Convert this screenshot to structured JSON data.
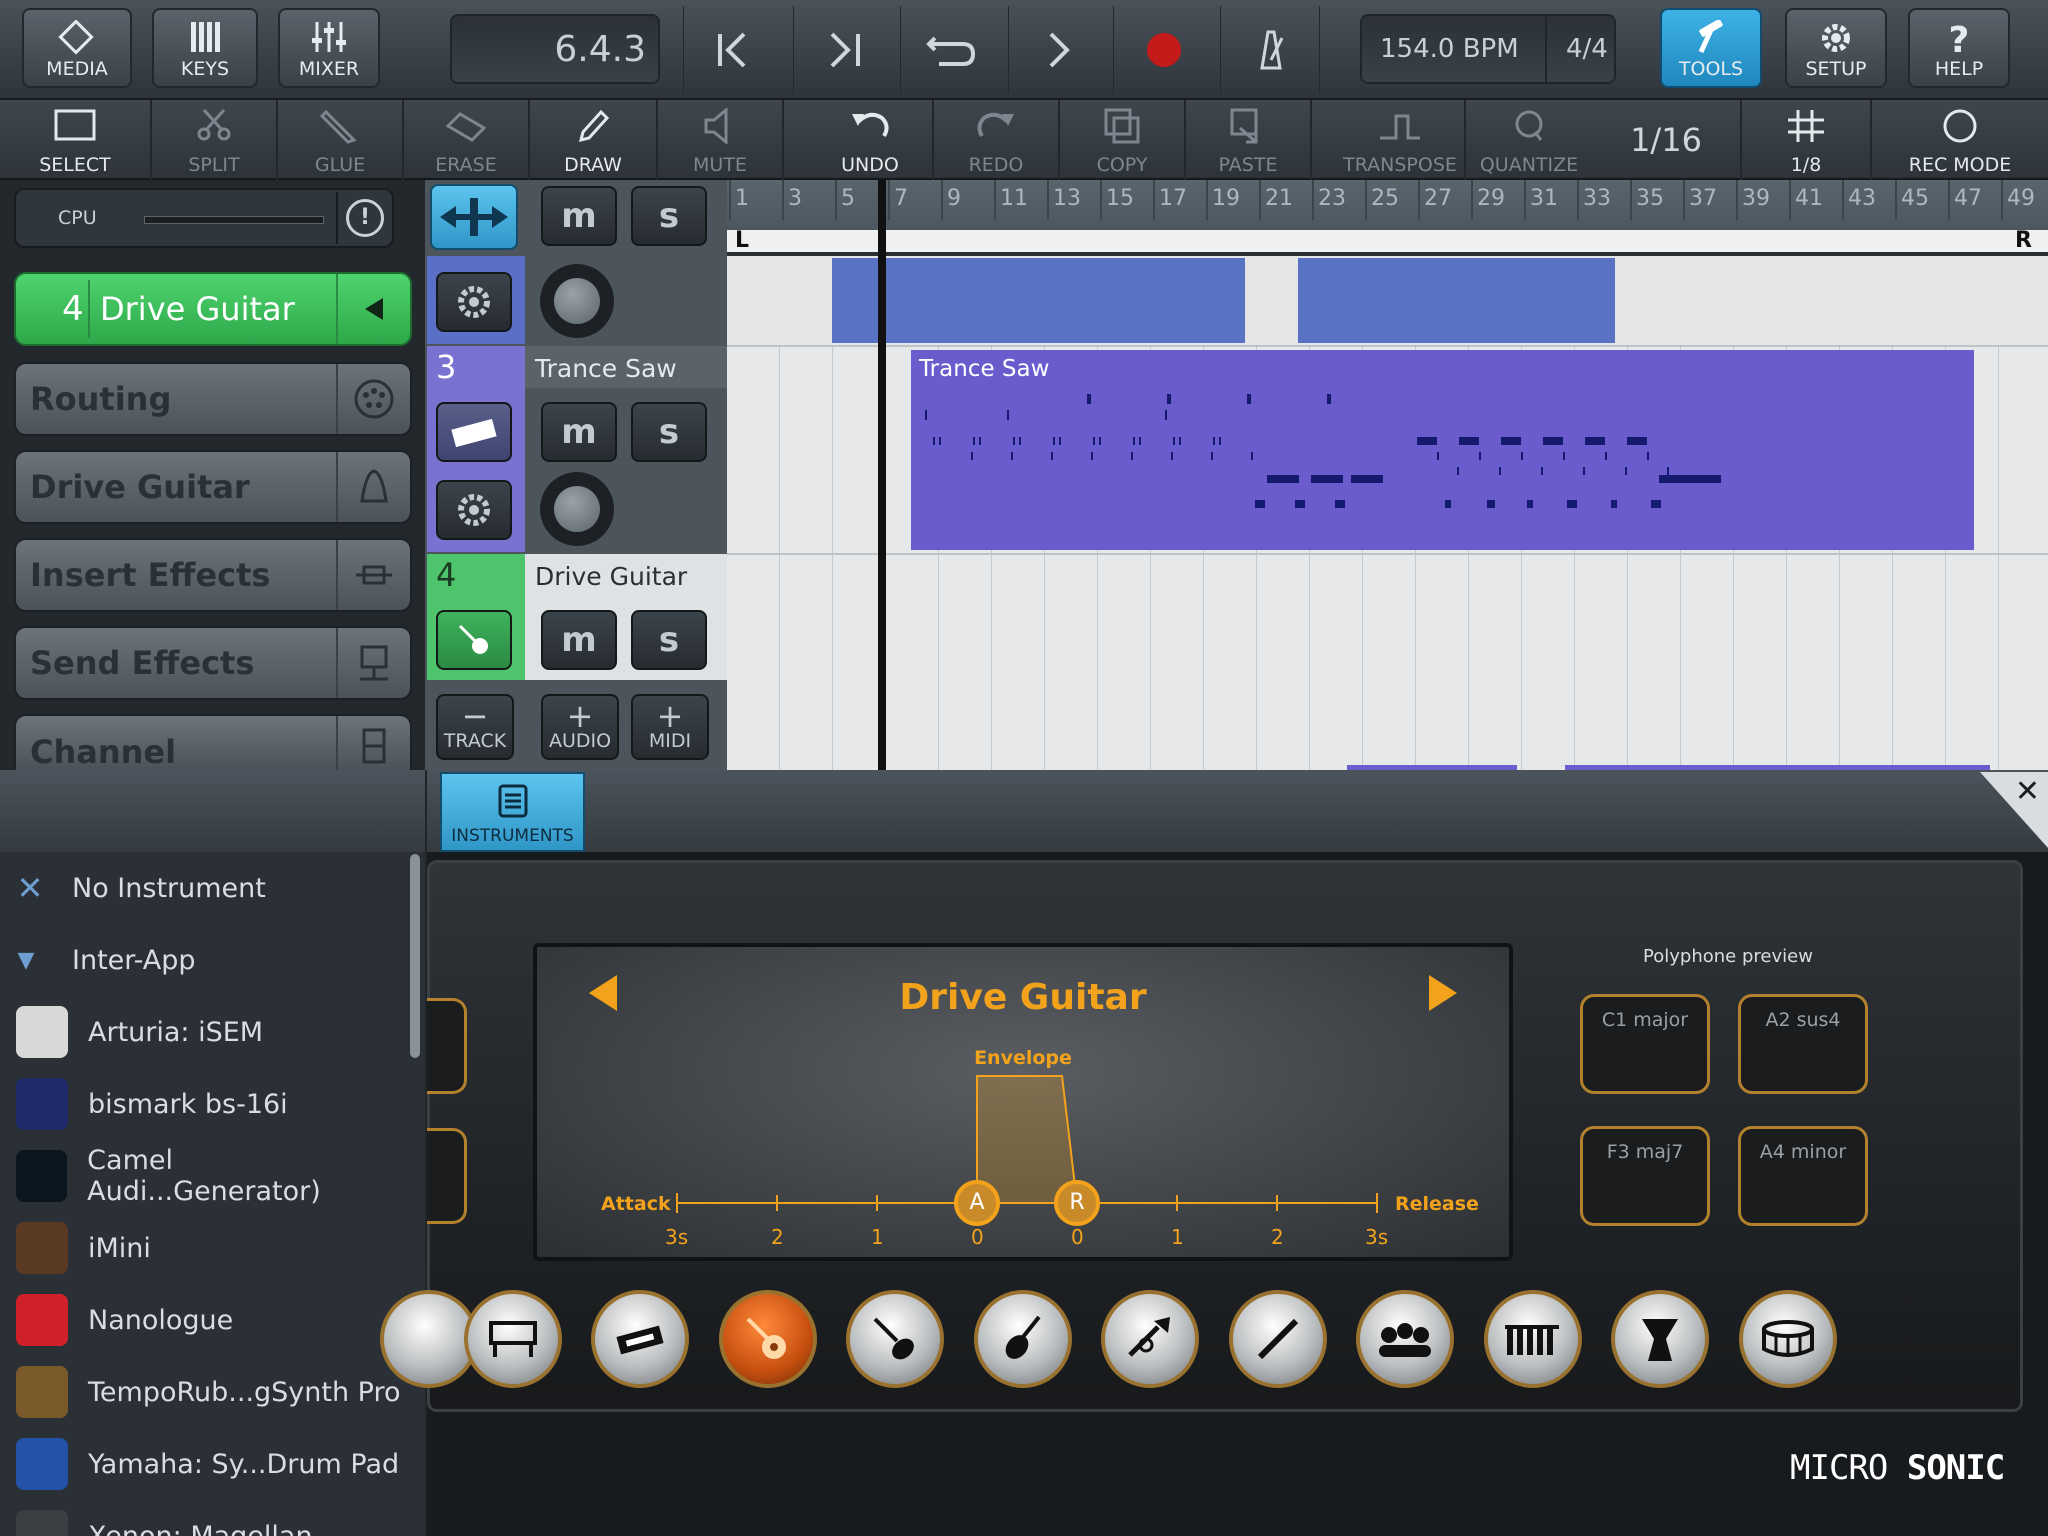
{
  "topbar": {
    "media": "MEDIA",
    "keys": "KEYS",
    "mixer": "MIXER",
    "position": "6.4.3",
    "tempo": "154.0 BPM",
    "signature": "4/4",
    "tools": "TOOLS",
    "setup": "SETUP",
    "help": "HELP"
  },
  "toolbar": {
    "select": "SELECT",
    "split": "SPLIT",
    "glue": "GLUE",
    "erase": "ERASE",
    "draw": "DRAW",
    "mute": "MUTE",
    "undo": "UNDO",
    "redo": "REDO",
    "copy": "COPY",
    "paste": "PASTE",
    "transpose": "TRANSPOSE",
    "quantize": "QUANTIZE",
    "quantize_value": "1/16",
    "grid": "1/8",
    "rec_mode": "REC MODE"
  },
  "left": {
    "cpu": "CPU",
    "track_num": "4",
    "track_name": "Drive Guitar",
    "routing": "Routing",
    "instrument": "Drive Guitar",
    "insert": "Insert Effects",
    "send": "Send Effects",
    "channel": "Channel"
  },
  "tracks": {
    "t3_num": "3",
    "t3_name": "Trance Saw",
    "t4_num": "4",
    "t4_name": "Drive Guitar",
    "m": "m",
    "s": "s",
    "track_btn": "TRACK",
    "audio_btn": "AUDIO",
    "midi_btn": "MIDI"
  },
  "ruler": {
    "numbers": [
      "1",
      "3",
      "5",
      "7",
      "9",
      "11",
      "13",
      "15",
      "17",
      "19",
      "21",
      "23",
      "25",
      "27",
      "29",
      "31",
      "33",
      "35",
      "37",
      "39",
      "41",
      "43",
      "45",
      "47",
      "49"
    ],
    "left_marker": "L",
    "right_marker": "R"
  },
  "clip": {
    "name": "Trance Saw"
  },
  "tabs": {
    "instruments": "INSTRUMENTS"
  },
  "browser": {
    "items": [
      {
        "label": "No Instrument",
        "icon": "x-icon"
      },
      {
        "label": "Inter-App",
        "icon": "triangle-down-icon"
      },
      {
        "label": "Arturia: iSEM",
        "color": "#d8d8d8"
      },
      {
        "label": "bismark bs-16i",
        "color": "#1f2a6b"
      },
      {
        "label": "Camel Audi...Generator)",
        "color": "#0b1620"
      },
      {
        "label": "iMini",
        "color": "#5a3a22"
      },
      {
        "label": "Nanologue",
        "color": "#d0202a"
      },
      {
        "label": "TempoRub...gSynth Pro",
        "color": "#7a5a2a"
      },
      {
        "label": "Yamaha: Sy...Drum Pad",
        "color": "#2352a8"
      },
      {
        "label": "Xenon: Magellan",
        "color": "#3a3f44"
      }
    ]
  },
  "synth": {
    "preset": "Drive Guitar",
    "envelope": "Envelope",
    "attack": "Attack",
    "release": "Release",
    "scale": [
      "3s",
      "2",
      "1",
      "0",
      "0",
      "1",
      "2",
      "3s"
    ],
    "a": "A",
    "r": "R",
    "poly_title": "Polyphone preview",
    "poly": [
      "C1 major",
      "A2 sus4",
      "F3 maj7",
      "A4 minor"
    ],
    "brand_a": "MICRO",
    "brand_b": "SONIC",
    "accent": "#f3a21b"
  }
}
